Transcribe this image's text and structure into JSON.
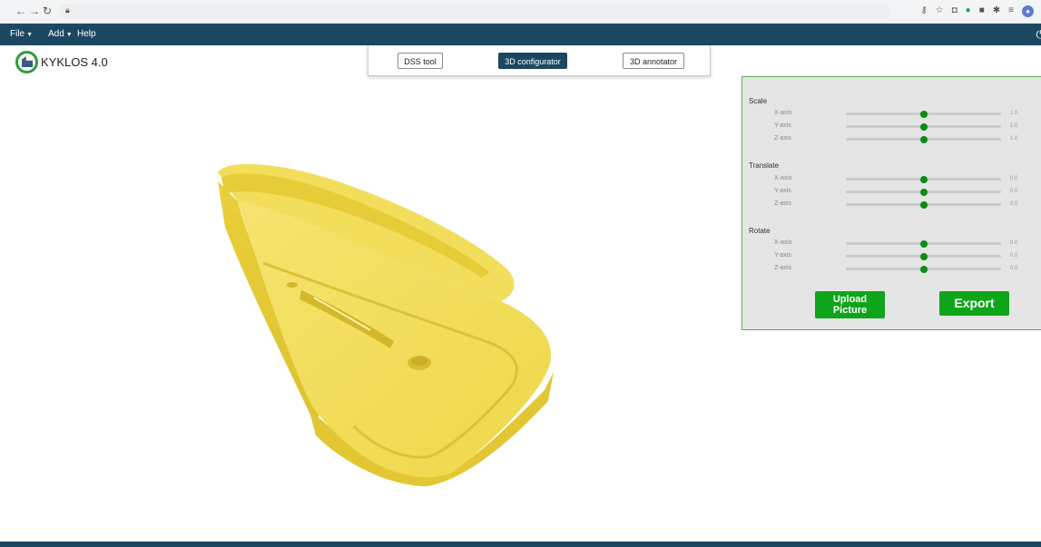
{
  "browser": {
    "back_icon": "arrow-left-icon",
    "forward_icon": "arrow-right-icon",
    "reload_icon": "reload-icon",
    "lock_icon": "lock-icon",
    "extensions": [
      "key-icon",
      "star-icon",
      "camera-icon",
      "grammarly-icon",
      "extension-square-icon",
      "puzzle-icon",
      "reading-list-icon",
      "profile-avatar-icon"
    ]
  },
  "menubar": {
    "file": "File",
    "add": "Add",
    "help": "Help",
    "power_icon": "power-icon"
  },
  "app": {
    "title": "KYKLOS 4.0"
  },
  "tabs": [
    {
      "label": "DSS tool",
      "active": false
    },
    {
      "label": "3D configurator",
      "active": true
    },
    {
      "label": "3D annotator",
      "active": false
    }
  ],
  "viewport": {
    "model_color": "#efd94a",
    "description_icon": "3d-model-holder"
  },
  "controls": {
    "sections": [
      {
        "title": "Scale",
        "rows": [
          {
            "label": "X-axis",
            "value": "1.0",
            "level": 0.5
          },
          {
            "label": "Y-axis",
            "value": "1.0",
            "level": 0.5
          },
          {
            "label": "Z-axis",
            "value": "1.0",
            "level": 0.5
          }
        ]
      },
      {
        "title": "Translate",
        "rows": [
          {
            "label": "X-axis",
            "value": "0.0",
            "level": 0.5
          },
          {
            "label": "Y-axis",
            "value": "0.0",
            "level": 0.5
          },
          {
            "label": "Z-axis",
            "value": "0.0",
            "level": 0.5
          }
        ]
      },
      {
        "title": "Rotate",
        "rows": [
          {
            "label": "X-axis",
            "value": "0.0",
            "level": 0.5
          },
          {
            "label": "Y-axis",
            "value": "0.0",
            "level": 0.5
          },
          {
            "label": "Z-axis",
            "value": "0.0",
            "level": 0.5
          }
        ]
      }
    ],
    "upload_line1": "Upload",
    "upload_line2": "Picture",
    "export_label": "Export",
    "accent": "#0fa51a"
  },
  "colors": {
    "navy": "#1c4760",
    "panel_border": "#59b24f"
  }
}
